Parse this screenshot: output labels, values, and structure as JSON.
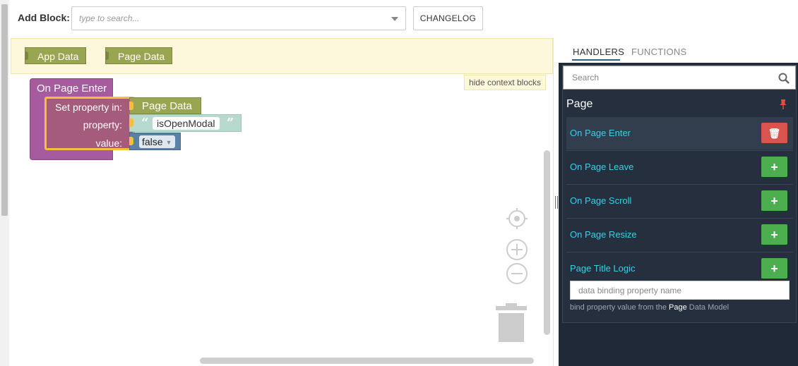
{
  "topbar": {
    "add_block_label": "Add Block:",
    "search_placeholder": "type to search...",
    "changelog_label": "CHANGELOG"
  },
  "context": {
    "blocks": [
      "App Data",
      "Page Data"
    ],
    "hide_label": "hide context blocks"
  },
  "workspace": {
    "event_title": "On Page Enter",
    "set_labels": {
      "set_in": "Set property in:",
      "property": "property:",
      "value": "value:"
    },
    "target_block": "Page Data",
    "property_value": "isOpenModal",
    "open_quote": "“",
    "close_quote": "”",
    "bool_value": "false",
    "dropdown_glyph": "▼"
  },
  "panel": {
    "tabs": [
      "HANDLERS",
      "FUNCTIONS"
    ],
    "active_tab": "HANDLERS",
    "search_placeholder": "Search",
    "section_title": "Page",
    "handlers": [
      {
        "label": "On Page Enter",
        "action": "delete",
        "glyph": "🗑"
      },
      {
        "label": "On Page Leave",
        "action": "add",
        "glyph": "+"
      },
      {
        "label": "On Page Scroll",
        "action": "add",
        "glyph": "+"
      },
      {
        "label": "On Page Resize",
        "action": "add",
        "glyph": "+"
      },
      {
        "label": "Page Title Logic",
        "action": "add",
        "glyph": "+"
      }
    ],
    "binding_placeholder": "data binding property name",
    "binding_help_prefix": "bind property value from the",
    "binding_help_model": "Page",
    "binding_help_suffix": "Data Model"
  },
  "colors": {
    "event_block": "#a55b9e",
    "set_block": "#a55b7b",
    "data_block": "#9aa552",
    "string_block": "#b7d9ce",
    "bool_block": "#5b80a5",
    "selection": "#f5be3c",
    "panel_bg": "#1f2937",
    "handler_text": "#38d0e6",
    "add_button": "#4cae4f",
    "delete_button": "#d9534f"
  }
}
